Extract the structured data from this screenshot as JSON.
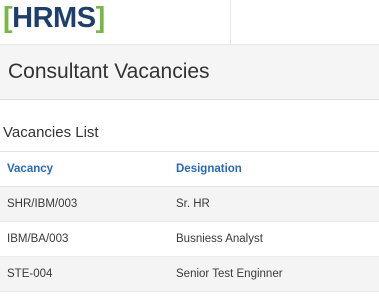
{
  "logo": {
    "open_bracket": "[",
    "text": "HRMS",
    "close_bracket": "]"
  },
  "page": {
    "title": "Consultant Vacancies"
  },
  "section": {
    "title": "Vacancies List"
  },
  "table": {
    "headers": [
      "Vacancy",
      "Designation"
    ],
    "rows": [
      [
        "SHR/IBM/003",
        "Sr. HR"
      ],
      [
        "IBM/BA/003",
        "Busniess Analyst"
      ],
      [
        "STE-004",
        "Senior Test Enginner"
      ]
    ]
  },
  "colors": {
    "logo_bracket": "#7ab648",
    "logo_text": "#1f3f6b",
    "table_header_text": "#2a6ab3"
  }
}
